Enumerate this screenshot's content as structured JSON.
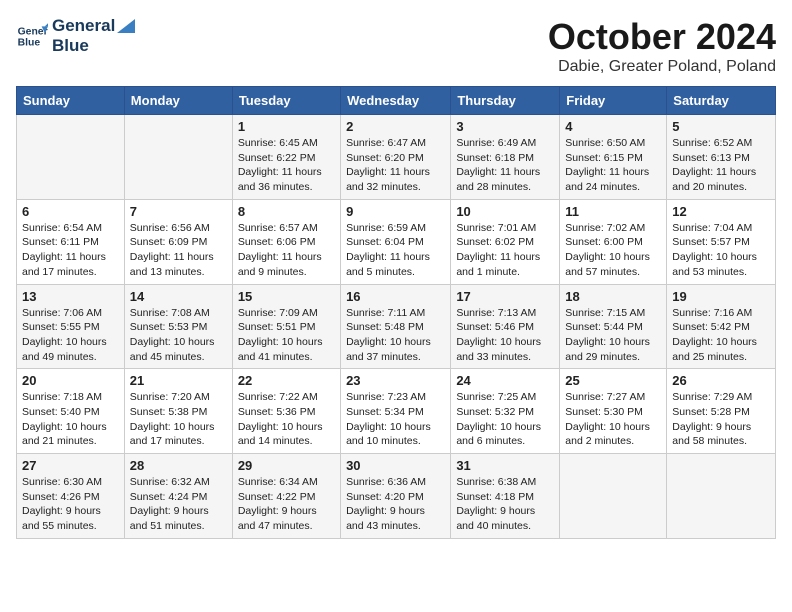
{
  "logo": {
    "line1": "General",
    "line2": "Blue"
  },
  "title": "October 2024",
  "location": "Dabie, Greater Poland, Poland",
  "days_header": [
    "Sunday",
    "Monday",
    "Tuesday",
    "Wednesday",
    "Thursday",
    "Friday",
    "Saturday"
  ],
  "weeks": [
    [
      {
        "day": "",
        "info": ""
      },
      {
        "day": "",
        "info": ""
      },
      {
        "day": "1",
        "info": "Sunrise: 6:45 AM\nSunset: 6:22 PM\nDaylight: 11 hours\nand 36 minutes."
      },
      {
        "day": "2",
        "info": "Sunrise: 6:47 AM\nSunset: 6:20 PM\nDaylight: 11 hours\nand 32 minutes."
      },
      {
        "day": "3",
        "info": "Sunrise: 6:49 AM\nSunset: 6:18 PM\nDaylight: 11 hours\nand 28 minutes."
      },
      {
        "day": "4",
        "info": "Sunrise: 6:50 AM\nSunset: 6:15 PM\nDaylight: 11 hours\nand 24 minutes."
      },
      {
        "day": "5",
        "info": "Sunrise: 6:52 AM\nSunset: 6:13 PM\nDaylight: 11 hours\nand 20 minutes."
      }
    ],
    [
      {
        "day": "6",
        "info": "Sunrise: 6:54 AM\nSunset: 6:11 PM\nDaylight: 11 hours\nand 17 minutes."
      },
      {
        "day": "7",
        "info": "Sunrise: 6:56 AM\nSunset: 6:09 PM\nDaylight: 11 hours\nand 13 minutes."
      },
      {
        "day": "8",
        "info": "Sunrise: 6:57 AM\nSunset: 6:06 PM\nDaylight: 11 hours\nand 9 minutes."
      },
      {
        "day": "9",
        "info": "Sunrise: 6:59 AM\nSunset: 6:04 PM\nDaylight: 11 hours\nand 5 minutes."
      },
      {
        "day": "10",
        "info": "Sunrise: 7:01 AM\nSunset: 6:02 PM\nDaylight: 11 hours\nand 1 minute."
      },
      {
        "day": "11",
        "info": "Sunrise: 7:02 AM\nSunset: 6:00 PM\nDaylight: 10 hours\nand 57 minutes."
      },
      {
        "day": "12",
        "info": "Sunrise: 7:04 AM\nSunset: 5:57 PM\nDaylight: 10 hours\nand 53 minutes."
      }
    ],
    [
      {
        "day": "13",
        "info": "Sunrise: 7:06 AM\nSunset: 5:55 PM\nDaylight: 10 hours\nand 49 minutes."
      },
      {
        "day": "14",
        "info": "Sunrise: 7:08 AM\nSunset: 5:53 PM\nDaylight: 10 hours\nand 45 minutes."
      },
      {
        "day": "15",
        "info": "Sunrise: 7:09 AM\nSunset: 5:51 PM\nDaylight: 10 hours\nand 41 minutes."
      },
      {
        "day": "16",
        "info": "Sunrise: 7:11 AM\nSunset: 5:48 PM\nDaylight: 10 hours\nand 37 minutes."
      },
      {
        "day": "17",
        "info": "Sunrise: 7:13 AM\nSunset: 5:46 PM\nDaylight: 10 hours\nand 33 minutes."
      },
      {
        "day": "18",
        "info": "Sunrise: 7:15 AM\nSunset: 5:44 PM\nDaylight: 10 hours\nand 29 minutes."
      },
      {
        "day": "19",
        "info": "Sunrise: 7:16 AM\nSunset: 5:42 PM\nDaylight: 10 hours\nand 25 minutes."
      }
    ],
    [
      {
        "day": "20",
        "info": "Sunrise: 7:18 AM\nSunset: 5:40 PM\nDaylight: 10 hours\nand 21 minutes."
      },
      {
        "day": "21",
        "info": "Sunrise: 7:20 AM\nSunset: 5:38 PM\nDaylight: 10 hours\nand 17 minutes."
      },
      {
        "day": "22",
        "info": "Sunrise: 7:22 AM\nSunset: 5:36 PM\nDaylight: 10 hours\nand 14 minutes."
      },
      {
        "day": "23",
        "info": "Sunrise: 7:23 AM\nSunset: 5:34 PM\nDaylight: 10 hours\nand 10 minutes."
      },
      {
        "day": "24",
        "info": "Sunrise: 7:25 AM\nSunset: 5:32 PM\nDaylight: 10 hours\nand 6 minutes."
      },
      {
        "day": "25",
        "info": "Sunrise: 7:27 AM\nSunset: 5:30 PM\nDaylight: 10 hours\nand 2 minutes."
      },
      {
        "day": "26",
        "info": "Sunrise: 7:29 AM\nSunset: 5:28 PM\nDaylight: 9 hours\nand 58 minutes."
      }
    ],
    [
      {
        "day": "27",
        "info": "Sunrise: 6:30 AM\nSunset: 4:26 PM\nDaylight: 9 hours\nand 55 minutes."
      },
      {
        "day": "28",
        "info": "Sunrise: 6:32 AM\nSunset: 4:24 PM\nDaylight: 9 hours\nand 51 minutes."
      },
      {
        "day": "29",
        "info": "Sunrise: 6:34 AM\nSunset: 4:22 PM\nDaylight: 9 hours\nand 47 minutes."
      },
      {
        "day": "30",
        "info": "Sunrise: 6:36 AM\nSunset: 4:20 PM\nDaylight: 9 hours\nand 43 minutes."
      },
      {
        "day": "31",
        "info": "Sunrise: 6:38 AM\nSunset: 4:18 PM\nDaylight: 9 hours\nand 40 minutes."
      },
      {
        "day": "",
        "info": ""
      },
      {
        "day": "",
        "info": ""
      }
    ]
  ]
}
